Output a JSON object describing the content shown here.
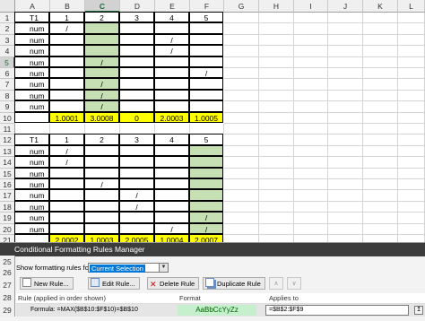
{
  "sheet": {
    "columns": [
      "A",
      "B",
      "C",
      "D",
      "E",
      "F",
      "G",
      "H",
      "I",
      "J",
      "K",
      "L"
    ],
    "selected_column": "C",
    "selected_row": 5,
    "rows": [
      {
        "n": 1,
        "cells": [
          "T1",
          "1",
          "2",
          "3",
          "4",
          "5"
        ]
      },
      {
        "n": 2,
        "cells": [
          "num",
          "/",
          "",
          "",
          "",
          ""
        ]
      },
      {
        "n": 3,
        "cells": [
          "num",
          "",
          "",
          "",
          "/",
          ""
        ]
      },
      {
        "n": 4,
        "cells": [
          "num",
          "",
          "",
          "",
          "/",
          ""
        ]
      },
      {
        "n": 5,
        "cells": [
          "num",
          "",
          "/",
          "",
          "",
          ""
        ]
      },
      {
        "n": 6,
        "cells": [
          "num",
          "",
          "",
          "",
          "",
          "/"
        ]
      },
      {
        "n": 7,
        "cells": [
          "num",
          "",
          "/",
          "",
          "",
          ""
        ]
      },
      {
        "n": 8,
        "cells": [
          "num",
          "",
          "/",
          "",
          "",
          ""
        ]
      },
      {
        "n": 9,
        "cells": [
          "num",
          "",
          "/",
          "",
          "",
          ""
        ]
      },
      {
        "n": 10,
        "cells": [
          "",
          "1.0001",
          "3.0008",
          "0",
          "2.0003",
          "1.0005"
        ]
      },
      {
        "n": 11,
        "cells": [
          "",
          "",
          "",
          "",
          "",
          ""
        ]
      },
      {
        "n": 12,
        "cells": [
          "T1",
          "1",
          "2",
          "3",
          "4",
          "5"
        ]
      },
      {
        "n": 13,
        "cells": [
          "num",
          "/",
          "",
          "",
          "",
          ""
        ]
      },
      {
        "n": 14,
        "cells": [
          "num",
          "/",
          "",
          "",
          "",
          ""
        ]
      },
      {
        "n": 15,
        "cells": [
          "num",
          "",
          "",
          "",
          "",
          ""
        ]
      },
      {
        "n": 16,
        "cells": [
          "num",
          "",
          "/",
          "",
          "",
          ""
        ]
      },
      {
        "n": 17,
        "cells": [
          "num",
          "",
          "",
          "/",
          "",
          ""
        ]
      },
      {
        "n": 18,
        "cells": [
          "num",
          "",
          "",
          "/",
          "",
          ""
        ]
      },
      {
        "n": 19,
        "cells": [
          "num",
          "",
          "",
          "",
          "",
          "/"
        ]
      },
      {
        "n": 20,
        "cells": [
          "num",
          "",
          "",
          "",
          "/",
          "/"
        ]
      },
      {
        "n": 21,
        "cells": [
          "",
          "2.0002",
          "1.0003",
          "2.0005",
          "1.0004",
          "2.0007"
        ]
      }
    ],
    "dialog_row_numbers": [
      "25",
      "26",
      "27",
      "28",
      "29"
    ]
  },
  "dialog": {
    "title": "Conditional Formatting Rules Manager",
    "show_label": "Show formatting rules for:",
    "show_value": "Current Selection",
    "buttons": {
      "new_rule": "New Rule...",
      "edit_rule": "Edit Rule...",
      "delete_rule": "Delete Rule",
      "duplicate_rule": "Duplicate Rule"
    },
    "list_headers": {
      "rule": "Rule (applied in order shown)",
      "format": "Format",
      "applies_to": "Applies to"
    },
    "rule": {
      "formula": "Formula: =MAX($B$10:$F$10)=$B$10",
      "preview": "AaBbCcYyZz",
      "applies_to": "=$B$2:$F$9"
    }
  },
  "colors": {
    "highlight_green": "#c6e0b4",
    "total_yellow": "#ffff00",
    "preview_bg": "#c6efce",
    "preview_text": "#006100",
    "dialog_title_bg": "#3c3c3c"
  }
}
